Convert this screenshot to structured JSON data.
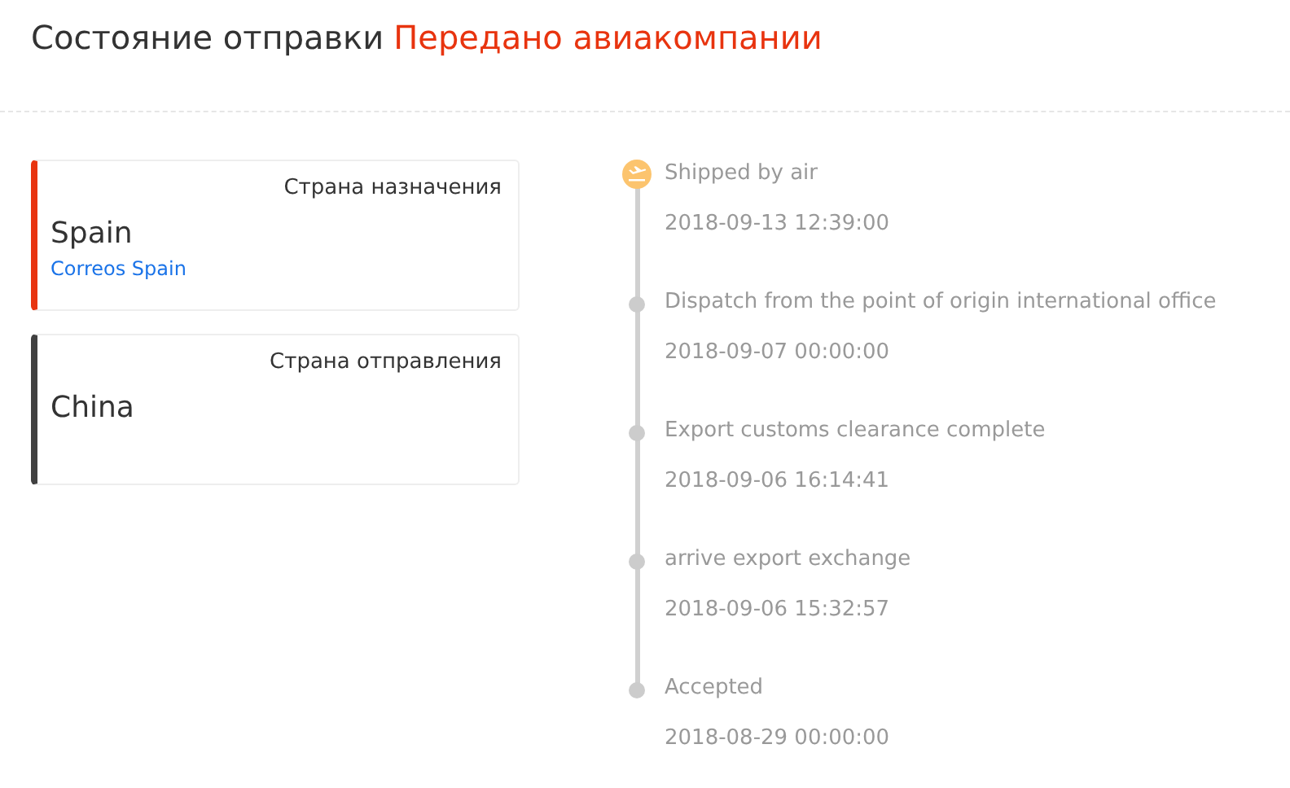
{
  "header": {
    "label": "Состояние отправки",
    "status": "Передано авиакомпании"
  },
  "cards": [
    {
      "caption": "Страна назначения",
      "country": "Spain",
      "carrier": "Correos Spain",
      "color": "#e8340f"
    },
    {
      "caption": "Страна отправления",
      "country": "China",
      "color": "#404040"
    }
  ],
  "events": [
    {
      "title": "Shipped by air",
      "time": "2018-09-13 12:39:00",
      "current": true
    },
    {
      "title": "Dispatch from the point of origin international office",
      "time": "2018-09-07 00:00:00",
      "current": false
    },
    {
      "title": "Export customs clearance complete",
      "time": "2018-09-06 16:14:41",
      "current": false
    },
    {
      "title": "arrive export exchange",
      "time": "2018-09-06 15:32:57",
      "current": false
    },
    {
      "title": "Accepted",
      "time": "2018-08-29 00:00:00",
      "current": false
    }
  ]
}
